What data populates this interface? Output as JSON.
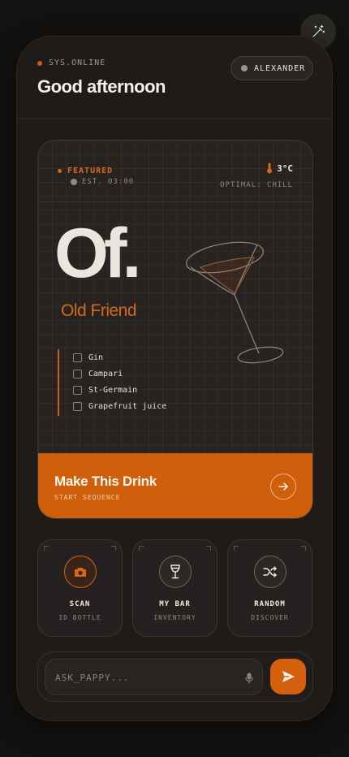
{
  "header": {
    "status_text": "SYS.ONLINE",
    "greeting": "Good afternoon",
    "user_name": "ALEXANDER"
  },
  "featured": {
    "tag": "FEATURED",
    "established": "EST. 03:00",
    "temperature": "3°C",
    "serving_note": "OPTIMAL: CHILL",
    "abbreviation": "Of.",
    "name": "Old Friend",
    "ingredients": [
      "Gin",
      "Campari",
      "St-Germain",
      "Grapefruit juice"
    ],
    "cta_title": "Make This Drink",
    "cta_subtitle": "START SEQUENCE"
  },
  "actions": [
    {
      "label": "SCAN",
      "sub": "ID BOTTLE",
      "icon": "camera-icon"
    },
    {
      "label": "MY BAR",
      "sub": "INVENTORY",
      "icon": "wine-glass-icon"
    },
    {
      "label": "RANDOM",
      "sub": "DISCOVER",
      "icon": "shuffle-icon"
    }
  ],
  "chat": {
    "placeholder": "ASK_PAPPY..."
  },
  "colors": {
    "accent": "#cf5f0b",
    "background": "#1e1b19"
  }
}
